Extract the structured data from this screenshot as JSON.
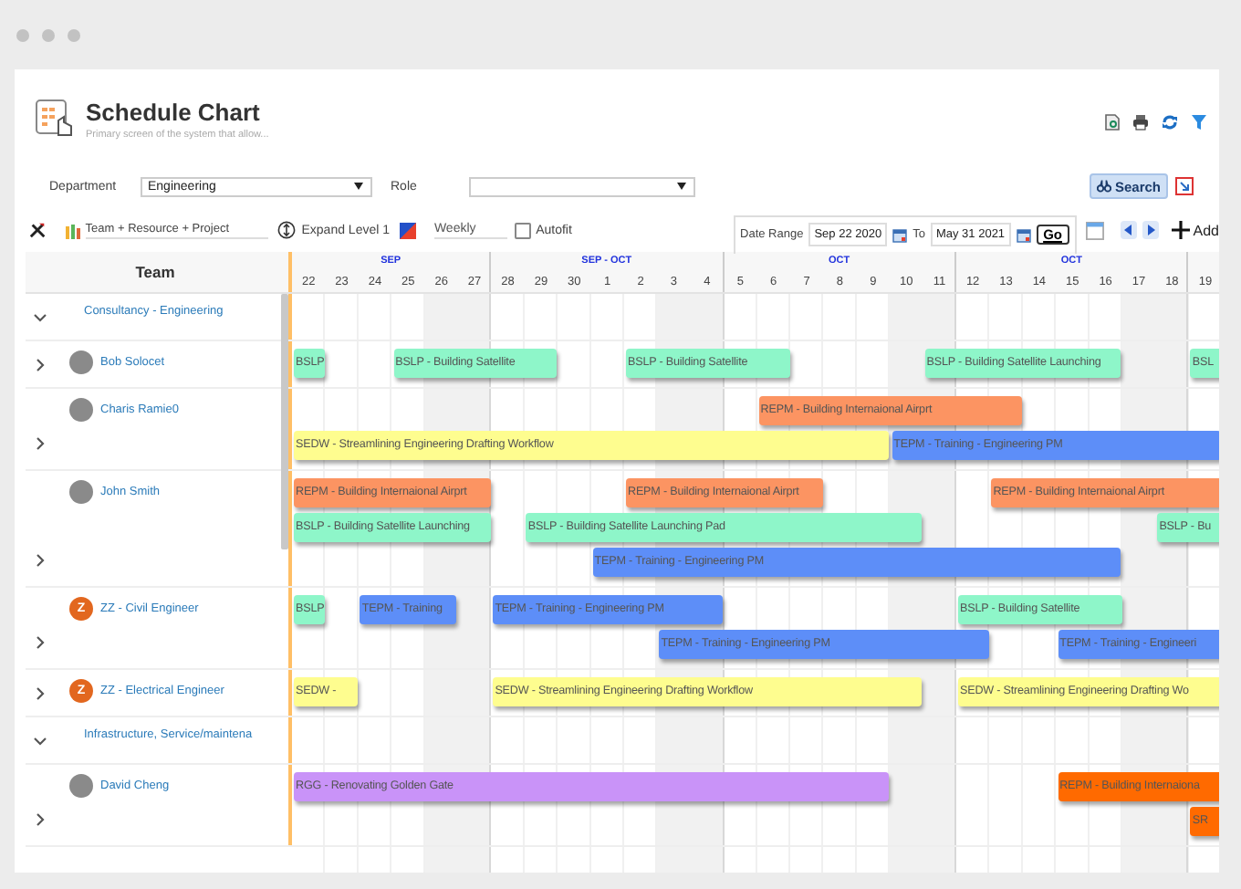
{
  "header": {
    "title": "Schedule Chart",
    "subtitle": "Primary screen of the system that allow..."
  },
  "filters": {
    "department": {
      "label": "Department",
      "value": "Engineering"
    },
    "role": {
      "label": "Role"
    },
    "search_button": "Search"
  },
  "toolbar": {
    "view": "Team + Resource + Project",
    "expand": "Expand Level 1",
    "scale": "Weekly",
    "autofit": {
      "label": "Autofit",
      "checked": false
    },
    "date_range": {
      "label": "Date Range",
      "from": "Sep 22 2020",
      "to_label": "To",
      "to": "May 31 2021",
      "go": "Go"
    },
    "add": "Add"
  },
  "gantt": {
    "team_heading": "Team",
    "months": [
      {
        "label": "SEP",
        "days": [
          {
            "label": "22",
            "weekend": false
          },
          {
            "label": "23",
            "weekend": false
          },
          {
            "label": "24",
            "weekend": false
          },
          {
            "label": "25",
            "weekend": false
          },
          {
            "label": "26",
            "weekend": true
          },
          {
            "label": "27",
            "weekend": true
          }
        ]
      },
      {
        "label": "SEP - OCT",
        "days": [
          {
            "label": "28",
            "weekend": false
          },
          {
            "label": "29",
            "weekend": false
          },
          {
            "label": "30",
            "weekend": false
          },
          {
            "label": "1",
            "weekend": false
          },
          {
            "label": "2",
            "weekend": false
          },
          {
            "label": "3",
            "weekend": true
          },
          {
            "label": "4",
            "weekend": true
          }
        ]
      },
      {
        "label": "OCT",
        "days": [
          {
            "label": "5",
            "weekend": false
          },
          {
            "label": "6",
            "weekend": false
          },
          {
            "label": "7",
            "weekend": false
          },
          {
            "label": "8",
            "weekend": false
          },
          {
            "label": "9",
            "weekend": false
          },
          {
            "label": "10",
            "weekend": true
          },
          {
            "label": "11",
            "weekend": true
          }
        ]
      },
      {
        "label": "OCT",
        "days": [
          {
            "label": "12",
            "weekend": false
          },
          {
            "label": "13",
            "weekend": false
          },
          {
            "label": "14",
            "weekend": false
          },
          {
            "label": "15",
            "weekend": false
          },
          {
            "label": "16",
            "weekend": false
          },
          {
            "label": "17",
            "weekend": true
          },
          {
            "label": "18",
            "weekend": true
          }
        ]
      },
      {
        "days": [
          {
            "label": "19",
            "weekend": false
          }
        ]
      }
    ],
    "rows": [
      {
        "kind": "group",
        "label": "Consultancy - Engineering",
        "expanded": true
      },
      {
        "kind": "resource",
        "name": "Bob Solocet",
        "expanded": false,
        "lanes": [
          [
            {
              "label": "BSLP",
              "color": "#8ef6c9"
            },
            {
              "label": "BSLP - Building Satellite",
              "color": "#8ef6c9"
            },
            {
              "label": "BSLP - Building Satellite",
              "color": "#8ef6c9"
            },
            {
              "label": "BSLP - Building Satellite Launching",
              "color": "#8ef6c9"
            },
            {
              "label": "BSL",
              "color": "#8ef6c9"
            }
          ]
        ]
      },
      {
        "kind": "resource",
        "name": "Charis Ramie0",
        "expanded": false,
        "lanes": [
          [
            {
              "label": "REPM - Building Internaional Airprt",
              "color": "#fc9462"
            }
          ],
          [
            {
              "label": "SEDW - Streamlining Engineering Drafting Workflow",
              "color": "#fefd8f"
            },
            {
              "label": "TEPM - Training - Engineering PM",
              "color": "#5d8ef8"
            }
          ]
        ]
      },
      {
        "kind": "resource",
        "name": "John Smith",
        "expanded": false,
        "lanes": [
          [
            {
              "label": "REPM - Building Internaional Airprt",
              "color": "#fc9462"
            },
            {
              "label": "REPM - Building Internaional Airprt",
              "color": "#fc9462"
            },
            {
              "label": "REPM - Building Internaional Airprt",
              "color": "#fc9462"
            }
          ],
          [
            {
              "label": "BSLP - Building Satellite Launching",
              "color": "#8ef6c9"
            },
            {
              "label": "BSLP - Building Satellite Launching Pad",
              "color": "#8ef6c9"
            },
            {
              "label": "BSLP - Bu",
              "color": "#8ef6c9"
            }
          ],
          [
            {
              "label": "TEPM - Training - Engineering PM",
              "color": "#5d8ef8"
            }
          ]
        ]
      },
      {
        "kind": "resource",
        "name": "ZZ - Civil Engineer",
        "avatar_letter": "Z",
        "expanded": false,
        "lanes": [
          [
            {
              "label": "BSLP",
              "color": "#8ef6c9"
            },
            {
              "label": "TEPM - Training",
              "color": "#5d8ef8"
            },
            {
              "label": "TEPM - Training - Engineering PM",
              "color": "#5d8ef8"
            },
            {
              "label": "BSLP - Building Satellite",
              "color": "#8ef6c9"
            }
          ],
          [
            {
              "label": "TEPM - Training - Engineering PM",
              "color": "#5d8ef8"
            },
            {
              "label": "TEPM - Training - Engineeri",
              "color": "#5d8ef8"
            }
          ]
        ]
      },
      {
        "kind": "resource",
        "name": "ZZ - Electrical Engineer",
        "avatar_letter": "Z",
        "expanded": false,
        "lanes": [
          [
            {
              "label": "SEDW -",
              "color": "#fefd8f"
            },
            {
              "label": "SEDW - Streamlining Engineering Drafting Workflow",
              "color": "#fefd8f"
            },
            {
              "label": "SEDW - Streamlining Engineering Drafting Wo",
              "color": "#fefd8f"
            }
          ]
        ]
      },
      {
        "kind": "group",
        "label": "Infrastructure, Service/maintena",
        "expanded": true
      },
      {
        "kind": "resource",
        "name": "David Cheng",
        "expanded": false,
        "lanes": [
          [
            {
              "label": "RGG - Renovating Golden Gate",
              "color": "#c993f8"
            },
            {
              "label": "REPM - Building Internaiona",
              "color": "#ff6a00"
            }
          ],
          [
            {
              "label": "SR",
              "color": "#ff6a00"
            }
          ]
        ]
      }
    ]
  }
}
